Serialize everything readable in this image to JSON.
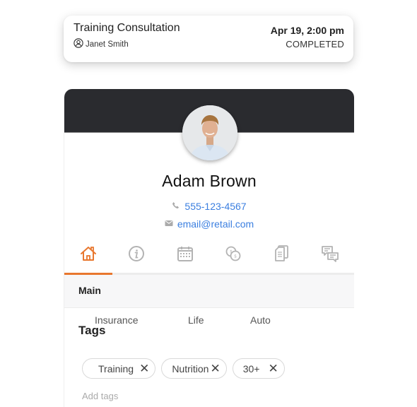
{
  "appointment": {
    "title": "Training Consultation",
    "person": "Janet Smith",
    "person_icon": "user-circle-icon",
    "datetime": "Apr 19, 2:00 pm",
    "status": "COMPLETED"
  },
  "profile": {
    "name": "Adam Brown",
    "phone": "555-123-4567",
    "phone_icon": "phone-icon",
    "email": "email@retail.com",
    "email_icon": "envelope-icon",
    "accent_color": "#e8772e",
    "link_color": "#3b7fe0",
    "header_color": "#2a2b2f"
  },
  "tabs": [
    {
      "icon": "home-icon",
      "active": true
    },
    {
      "icon": "info-icon",
      "active": false
    },
    {
      "icon": "calendar-icon",
      "active": false
    },
    {
      "icon": "coins-icon",
      "active": false
    },
    {
      "icon": "documents-icon",
      "active": false
    },
    {
      "icon": "chat-icon",
      "active": false
    }
  ],
  "section": {
    "title": "Main",
    "subtabs": [
      "Insurance",
      "Life",
      "Auto"
    ]
  },
  "tags": {
    "title": "Tags",
    "items": [
      "Training",
      "Nutrition",
      "30+"
    ],
    "remove_glyph": "✕",
    "add_placeholder": "Add tags"
  }
}
